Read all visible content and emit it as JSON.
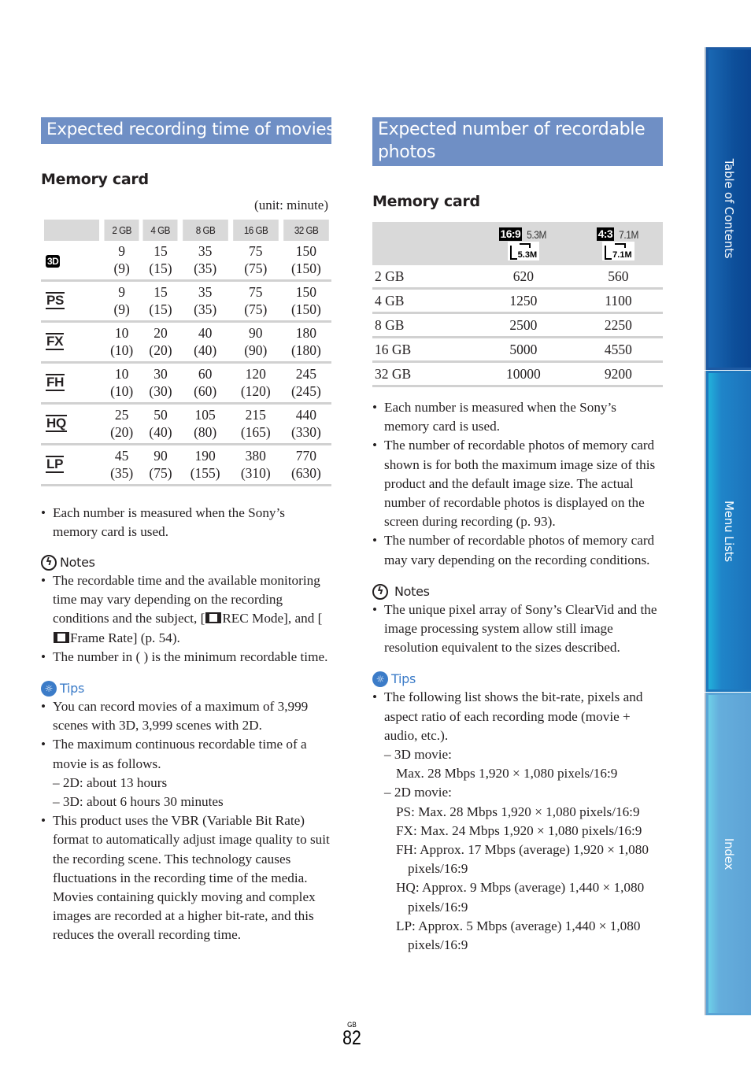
{
  "left": {
    "title": "Expected recording time of movies",
    "subhead": "Memory card",
    "unit": "(unit: minute)",
    "table": {
      "columns": [
        "",
        "2 GB",
        "4 GB",
        "8 GB",
        "16 GB",
        "32 GB"
      ],
      "rows": [
        {
          "mode": "3D",
          "icon": "3d-mode-icon",
          "values": [
            {
              "max": "9",
              "min": "(9)"
            },
            {
              "max": "15",
              "min": "(15)"
            },
            {
              "max": "35",
              "min": "(35)"
            },
            {
              "max": "75",
              "min": "(75)"
            },
            {
              "max": "150",
              "min": "(150)"
            }
          ]
        },
        {
          "mode": "PS",
          "icon": "ps-mode-icon",
          "values": [
            {
              "max": "9",
              "min": "(9)"
            },
            {
              "max": "15",
              "min": "(15)"
            },
            {
              "max": "35",
              "min": "(35)"
            },
            {
              "max": "75",
              "min": "(75)"
            },
            {
              "max": "150",
              "min": "(150)"
            }
          ]
        },
        {
          "mode": "FX",
          "icon": "fx-mode-icon",
          "values": [
            {
              "max": "10",
              "min": "(10)"
            },
            {
              "max": "20",
              "min": "(20)"
            },
            {
              "max": "40",
              "min": "(40)"
            },
            {
              "max": "90",
              "min": "(90)"
            },
            {
              "max": "180",
              "min": "(180)"
            }
          ]
        },
        {
          "mode": "FH",
          "icon": "fh-mode-icon",
          "values": [
            {
              "max": "10",
              "min": "(10)"
            },
            {
              "max": "30",
              "min": "(30)"
            },
            {
              "max": "60",
              "min": "(60)"
            },
            {
              "max": "120",
              "min": "(120)"
            },
            {
              "max": "245",
              "min": "(245)"
            }
          ]
        },
        {
          "mode": "HQ",
          "icon": "hq-mode-icon",
          "values": [
            {
              "max": "25",
              "min": "(20)"
            },
            {
              "max": "50",
              "min": "(40)"
            },
            {
              "max": "105",
              "min": "(80)"
            },
            {
              "max": "215",
              "min": "(165)"
            },
            {
              "max": "440",
              "min": "(330)"
            }
          ]
        },
        {
          "mode": "LP",
          "icon": "lp-mode-icon",
          "values": [
            {
              "max": "45",
              "min": "(35)"
            },
            {
              "max": "90",
              "min": "(75)"
            },
            {
              "max": "190",
              "min": "(155)"
            },
            {
              "max": "380",
              "min": "(310)"
            },
            {
              "max": "770",
              "min": "(630)"
            }
          ]
        }
      ]
    },
    "bullets": [
      "Each number is measured when the Sony’s memory card is used."
    ],
    "notes": {
      "label": "Notes",
      "items": [
        {
          "parts": [
            "The recordable time and the available monitoring time may vary depending on the recording conditions and the subject, [",
            "REC Mode], and [",
            "Frame Rate] (p. 54)."
          ]
        },
        {
          "text": "The number in ( ) is the minimum recordable time."
        }
      ]
    },
    "tips": {
      "label": "Tips",
      "items": [
        {
          "text": "You can record movies of a maximum of 3,999 scenes with 3D, 3,999 scenes with 2D."
        },
        {
          "text": "The maximum continuous recordable time of a movie is as follows.",
          "sub": [
            "– 2D: about 13 hours",
            "– 3D: about 6 hours 30 minutes"
          ]
        },
        {
          "text": "This product uses the VBR (Variable Bit Rate) format to automatically adjust image quality to suit the recording scene. This technology causes fluctuations in the recording time of the media. Movies containing quickly moving and complex images are recorded at a higher bit-rate, and this reduces the overall recording time."
        }
      ]
    }
  },
  "right": {
    "title": "Expected number of recordable photos",
    "subhead": "Memory card",
    "table": {
      "columns": [
        {
          "aspect": "16:9",
          "size": "5.3M",
          "icon_label": "5.3M"
        },
        {
          "aspect": "4:3",
          "size": "7.1M",
          "icon_label": "7.1M"
        }
      ],
      "rows": [
        {
          "capacity": "2 GB",
          "values": [
            "620",
            "560"
          ]
        },
        {
          "capacity": "4 GB",
          "values": [
            "1250",
            "1100"
          ]
        },
        {
          "capacity": "8 GB",
          "values": [
            "2500",
            "2250"
          ]
        },
        {
          "capacity": "16 GB",
          "values": [
            "5000",
            "4550"
          ]
        },
        {
          "capacity": "32 GB",
          "values": [
            "10000",
            "9200"
          ]
        }
      ]
    },
    "bullets": [
      "Each number is measured when the Sony’s memory card is used.",
      "The number of recordable photos of memory card shown is for both the maximum image size of this product and the default image size. The actual number of recordable photos is displayed on the screen during recording (p. 93).",
      "The number of recordable photos of memory card may vary depending on the recording conditions."
    ],
    "notes": {
      "label": "Notes",
      "items": [
        "The unique pixel array of Sony’s ClearVid and the image processing system allow still image resolution equivalent to the sizes described."
      ]
    },
    "tips": {
      "label": "Tips",
      "intro": "The following list shows the bit-rate, pixels and aspect ratio of each recording mode (movie + audio, etc.).",
      "groups": [
        {
          "heading": "– 3D movie:",
          "lines": [
            "Max. 28 Mbps 1,920 × 1,080 pixels/16:9"
          ]
        },
        {
          "heading": "– 2D movie:",
          "lines": [
            "PS: Max. 28 Mbps 1,920 × 1,080 pixels/16:9",
            "FX: Max. 24 Mbps 1,920 × 1,080 pixels/16:9",
            "FH: Approx. 17 Mbps (average) 1,920 × 1,080 pixels/16:9",
            "HQ: Approx. 9 Mbps (average) 1,440 × 1,080 pixels/16:9",
            "LP: Approx. 5 Mbps (average) 1,440 × 1,080 pixels/16:9"
          ]
        }
      ]
    }
  },
  "side_tabs": [
    {
      "label": "Table of Contents"
    },
    {
      "label": "Menu Lists"
    },
    {
      "label": "Index"
    }
  ],
  "footer": {
    "region": "GB",
    "page": "82"
  },
  "colors": {
    "section_title_bg": "#6f8fc5",
    "tips_accent": "#3c7cc8",
    "table_header_bg": "#d9d9d9"
  }
}
